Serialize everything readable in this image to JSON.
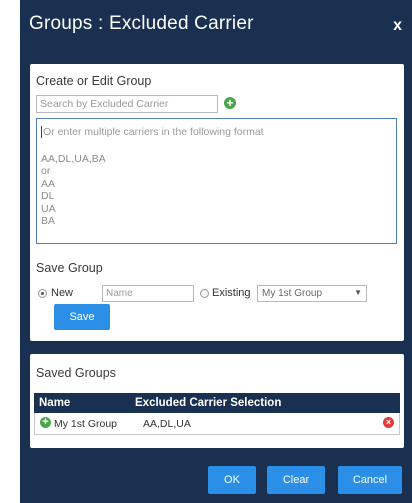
{
  "dialog": {
    "title": "Groups : Excluded Carrier",
    "close_label": "x"
  },
  "create_group": {
    "heading": "Create or Edit Group",
    "search_placeholder": "Search by Excluded Carrier",
    "add_icon": "plus-circle-icon",
    "carriers_placeholder": "Or enter multiple carriers in the following format",
    "format_lines": [
      "AA,DL,UA,BA",
      "or",
      "AA",
      "DL",
      "UA",
      "BA"
    ]
  },
  "save_group": {
    "heading": "Save Group",
    "new_label": "New",
    "new_selected": true,
    "name_placeholder": "Name",
    "existing_label": "Existing",
    "existing_selected": false,
    "existing_select_value": "My 1st Group",
    "save_label": "Save"
  },
  "saved_groups": {
    "heading": "Saved Groups",
    "columns": [
      "Name",
      "Excluded Carrier Selection"
    ],
    "rows": [
      {
        "name": "My 1st Group",
        "selection": "AA,DL,UA",
        "edit_icon": "plus-circle-icon",
        "remove_icon": "remove-circle-icon"
      }
    ]
  },
  "footer": {
    "ok_label": "OK",
    "clear_label": "Clear",
    "cancel_label": "Cancel"
  },
  "colors": {
    "dialog_background": "#1a3050",
    "button_blue": "#2b8fe8",
    "add_green": "#4aa64a",
    "remove_red": "#e23b3b"
  }
}
